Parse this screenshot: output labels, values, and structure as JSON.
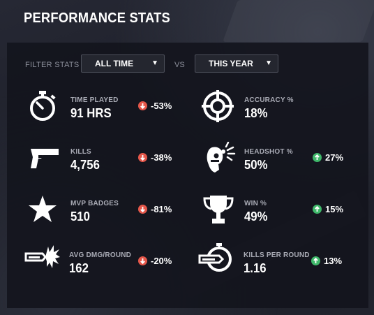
{
  "title": "PERFORMANCE STATS",
  "filter": {
    "label": "FILTER STATS",
    "primary": "ALL TIME",
    "vs_label": "VS",
    "compare": "THIS YEAR"
  },
  "stats": [
    {
      "label": "TIME PLAYED",
      "value": "91 HRS",
      "change": "-53%",
      "direction": "down",
      "icon": "stopwatch-icon"
    },
    {
      "label": "ACCURACY %",
      "value": "18%",
      "change": "",
      "direction": "",
      "icon": "crosshair-icon"
    },
    {
      "label": "KILLS",
      "value": "4,756",
      "change": "-38%",
      "direction": "down",
      "icon": "pistol-icon"
    },
    {
      "label": "HEADSHOT %",
      "value": "50%",
      "change": "27%",
      "direction": "up",
      "icon": "headshot-icon"
    },
    {
      "label": "MVP BADGES",
      "value": "510",
      "change": "-81%",
      "direction": "down",
      "icon": "star-icon"
    },
    {
      "label": "WIN %",
      "value": "49%",
      "change": "15%",
      "direction": "up",
      "icon": "trophy-icon"
    },
    {
      "label": "AVG DMG/ROUND",
      "value": "162",
      "change": "-20%",
      "direction": "down",
      "icon": "bullet-impact-icon"
    },
    {
      "label": "KILLS PER ROUND",
      "value": "1.16",
      "change": "13%",
      "direction": "up",
      "icon": "bullet-timer-icon"
    }
  ],
  "colors": {
    "down": "#e5574a",
    "up": "#3fb86a",
    "panel": "#14151d"
  }
}
